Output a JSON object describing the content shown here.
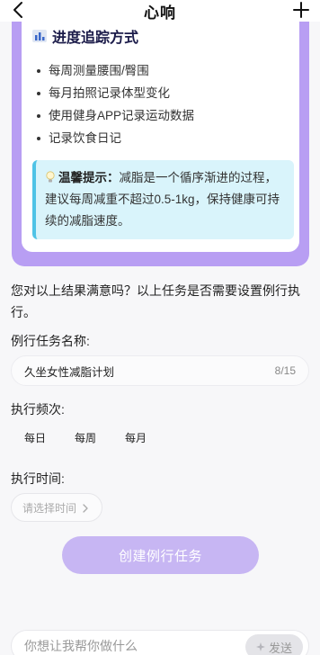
{
  "header": {
    "title": "心响",
    "back_icon": "chevron-left-icon",
    "add_icon": "plus-icon"
  },
  "card": {
    "section_title": "进度追踪方式",
    "section_icon": "bar-chart-icon",
    "items": [
      "每周测量腰围/臀围",
      "每月拍照记录体型变化",
      "使用健身APP记录运动数据",
      "记录饮食日记"
    ],
    "tip": {
      "icon": "lightbulb-icon",
      "label": "温馨提示：",
      "text": "减脂是一个循序渐进的过程，建议每周减重不超过0.5-1kg，保持健康可持续的减脂速度。"
    }
  },
  "question": "您对以上结果满意吗？以上任务是否需要设置例行执行。",
  "form": {
    "name_label": "例行任务名称:",
    "name_value": "久坐女性减脂计划",
    "name_count": "8/15",
    "freq_label": "执行频次:",
    "freq_options": [
      "每日",
      "每周",
      "每月"
    ],
    "time_label": "执行时间:",
    "time_placeholder": "请选择时间",
    "create_button": "创建例行任务"
  },
  "composer": {
    "placeholder": "你想让我帮你做什么",
    "send_label": "发送",
    "send_icon": "sparkle-icon"
  },
  "colors": {
    "accent": "#b89ef3",
    "button": "#c7b6f3",
    "tip_bg": "#d9f4fb",
    "tip_border": "#4fc3e6"
  }
}
